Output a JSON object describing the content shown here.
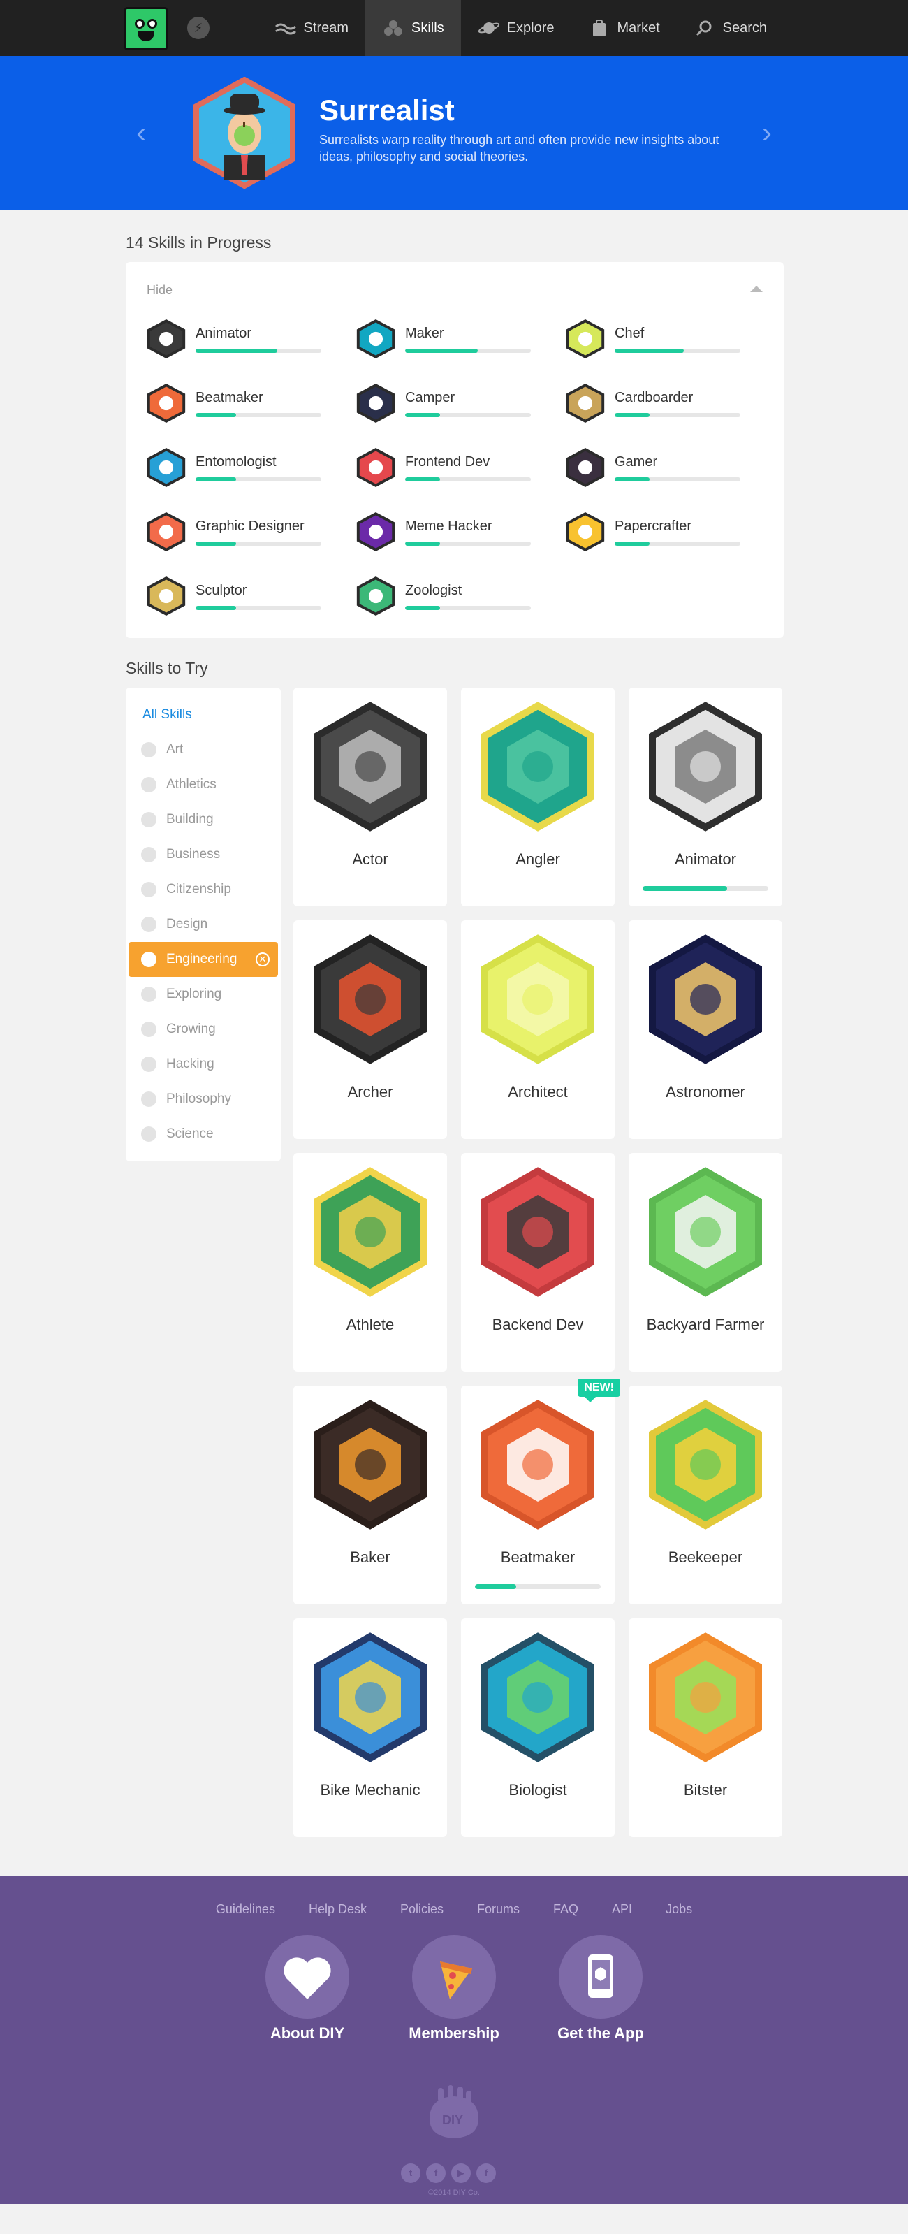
{
  "nav": {
    "items": [
      {
        "label": "Stream",
        "icon": "stream-icon"
      },
      {
        "label": "Skills",
        "icon": "skills-icon",
        "active": true
      },
      {
        "label": "Explore",
        "icon": "planet-icon"
      },
      {
        "label": "Market",
        "icon": "bag-icon"
      },
      {
        "label": "Search",
        "icon": "search-icon"
      }
    ]
  },
  "hero": {
    "title": "Surrealist",
    "description": "Surrealists warp reality through art and often provide new insights about ideas, philosophy and social theories.",
    "color": "#0b5fe8"
  },
  "progress": {
    "title": "14 Skills in Progress",
    "hide_label": "Hide",
    "skills": [
      {
        "name": "Animator",
        "progress": 0.65,
        "color": "#3a3a3a"
      },
      {
        "name": "Maker",
        "progress": 0.58,
        "color": "#12a7c2"
      },
      {
        "name": "Chef",
        "progress": 0.55,
        "color": "#d6e85a"
      },
      {
        "name": "Beatmaker",
        "progress": 0.32,
        "color": "#ef6a3a"
      },
      {
        "name": "Camper",
        "progress": 0.28,
        "color": "#2a2f4a"
      },
      {
        "name": "Cardboarder",
        "progress": 0.28,
        "color": "#c9a45a"
      },
      {
        "name": "Entomologist",
        "progress": 0.32,
        "color": "#27a0d6"
      },
      {
        "name": "Frontend Dev",
        "progress": 0.28,
        "color": "#e5484d"
      },
      {
        "name": "Gamer",
        "progress": 0.28,
        "color": "#3a2f3f"
      },
      {
        "name": "Graphic Designer",
        "progress": 0.32,
        "color": "#f26b4a"
      },
      {
        "name": "Meme Hacker",
        "progress": 0.28,
        "color": "#6b2aa8"
      },
      {
        "name": "Papercrafter",
        "progress": 0.28,
        "color": "#f8c22f"
      },
      {
        "name": "Sculptor",
        "progress": 0.32,
        "color": "#d9b85a"
      },
      {
        "name": "Zoologist",
        "progress": 0.28,
        "color": "#3cb878"
      }
    ]
  },
  "try": {
    "title": "Skills to Try",
    "filters": [
      {
        "label": "All Skills",
        "kind": "all"
      },
      {
        "label": "Art"
      },
      {
        "label": "Athletics"
      },
      {
        "label": "Building"
      },
      {
        "label": "Business"
      },
      {
        "label": "Citizenship"
      },
      {
        "label": "Design"
      },
      {
        "label": "Engineering",
        "active": true
      },
      {
        "label": "Exploring"
      },
      {
        "label": "Growing"
      },
      {
        "label": "Hacking"
      },
      {
        "label": "Philosophy"
      },
      {
        "label": "Science"
      }
    ],
    "cards": [
      {
        "name": "Actor",
        "fill": "#4a4a4a",
        "stroke": "#2b2b2b",
        "inner": "#bdbdbd"
      },
      {
        "name": "Angler",
        "fill": "#1fa58c",
        "stroke": "#e8d94a",
        "inner": "#52c7a2"
      },
      {
        "name": "Animator",
        "fill": "#e3e3e3",
        "stroke": "#2e2e2e",
        "inner": "#7d7d7d",
        "progress": 0.67
      },
      {
        "name": "Archer",
        "fill": "#3a3a3a",
        "stroke": "#232323",
        "inner": "#e9542f"
      },
      {
        "name": "Architect",
        "fill": "#e8f26b",
        "stroke": "#d6e048",
        "inner": "#f5f9b0"
      },
      {
        "name": "Astronomer",
        "fill": "#1f2358",
        "stroke": "#141842",
        "inner": "#f3c86b"
      },
      {
        "name": "Athlete",
        "fill": "#3ea257",
        "stroke": "#f0d44a",
        "inner": "#f5d04a"
      },
      {
        "name": "Backend Dev",
        "fill": "#e24c4f",
        "stroke": "#c43b3e",
        "inner": "#3b3b3b"
      },
      {
        "name": "Backyard Farmer",
        "fill": "#6fcf62",
        "stroke": "#5cb851",
        "inner": "#f4f4f4"
      },
      {
        "name": "Baker",
        "fill": "#3b2b26",
        "stroke": "#2a1e1a",
        "inner": "#f29a2e"
      },
      {
        "name": "Beatmaker",
        "fill": "#ef6a3a",
        "stroke": "#d8552a",
        "inner": "#ffffff",
        "progress": 0.33,
        "is_new": true,
        "new_label": "NEW!"
      },
      {
        "name": "Beekeeper",
        "fill": "#5fc95a",
        "stroke": "#e2c93a",
        "inner": "#f7d13a"
      },
      {
        "name": "Bike Mechanic",
        "fill": "#3b8fd9",
        "stroke": "#233a6b",
        "inner": "#f1d64a"
      },
      {
        "name": "Biologist",
        "fill": "#23a6c9",
        "stroke": "#245067",
        "inner": "#6bd36a"
      },
      {
        "name": "Bitster",
        "fill": "#f7a040",
        "stroke": "#f28a2a",
        "inner": "#97e25a"
      }
    ]
  },
  "footer": {
    "links": [
      "Guidelines",
      "Help Desk",
      "Policies",
      "Forums",
      "FAQ",
      "API",
      "Jobs"
    ],
    "big": [
      {
        "label": "About DIY",
        "icon": "heart-icon"
      },
      {
        "label": "Membership",
        "icon": "pizza-icon"
      },
      {
        "label": "Get the App",
        "icon": "phone-icon"
      }
    ],
    "social": [
      "t",
      "f",
      "▶",
      "f"
    ],
    "copyright": "©2014 DIY Co.",
    "color": "#65508f"
  }
}
